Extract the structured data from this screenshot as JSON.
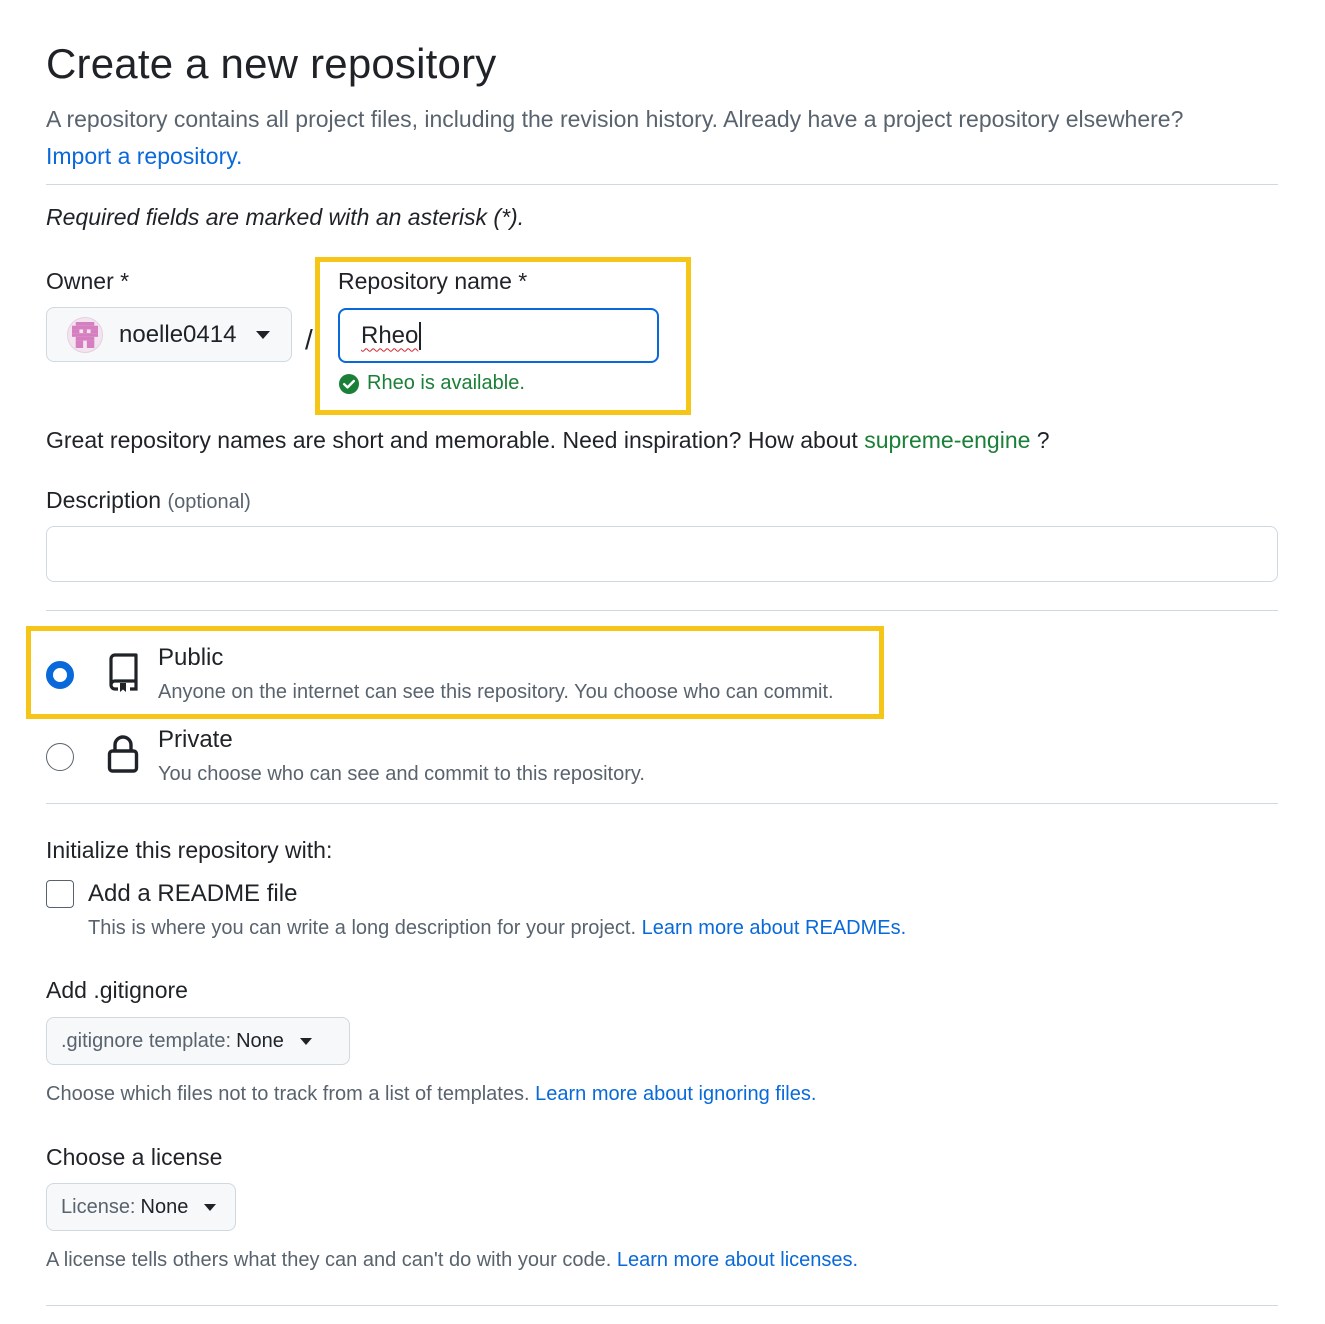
{
  "header": {
    "title": "Create a new repository",
    "subtitle": "A repository contains all project files, including the revision history. Already have a project repository elsewhere?",
    "import_link": "Import a repository."
  },
  "form": {
    "required_note": "Required fields are marked with an asterisk (*).",
    "owner": {
      "label": "Owner *",
      "value": "noelle0414",
      "avatar_icon": "pixel-avatar-icon"
    },
    "separator": "/",
    "repo_name": {
      "label": "Repository name *",
      "value": "Rheo",
      "availability": "Rheo is available."
    },
    "suggestion": {
      "text": "Great repository names are short and memorable. Need inspiration? How about",
      "name": "supreme-engine",
      "suffix": " ?"
    },
    "description": {
      "label": "Description",
      "optional": "(optional)",
      "value": ""
    },
    "visibility": {
      "public": {
        "title": "Public",
        "desc": "Anyone on the internet can see this repository. You choose who can commit.",
        "selected": true,
        "icon": "repo-icon"
      },
      "private": {
        "title": "Private",
        "desc": "You choose who can see and commit to this repository.",
        "selected": false,
        "icon": "lock-icon"
      }
    },
    "init": {
      "heading": "Initialize this repository with:",
      "readme": {
        "label": "Add a README file",
        "desc": "This is where you can write a long description for your project.",
        "link": "Learn more about READMEs.",
        "checked": false
      }
    },
    "gitignore": {
      "heading": "Add .gitignore",
      "key": ".gitignore template:",
      "value": "None",
      "desc": "Choose which files not to track from a list of templates.",
      "link": "Learn more about ignoring files."
    },
    "license": {
      "heading": "Choose a license",
      "key": "License:",
      "value": "None",
      "desc": "A license tells others what they can and can't do with your code.",
      "link": "Learn more about licenses."
    }
  },
  "colors": {
    "accent": "#0969da",
    "success": "#1a7f37",
    "highlight": "#f5c518"
  }
}
